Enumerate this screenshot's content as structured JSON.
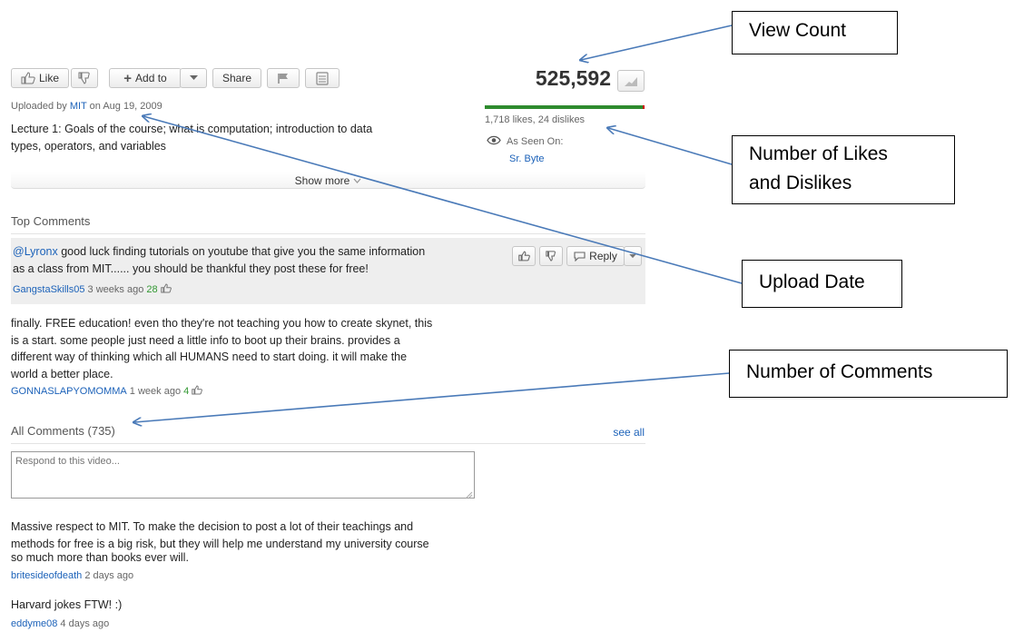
{
  "toolbar": {
    "like_label": "Like",
    "add_to_label": "Add to",
    "share_label": "Share"
  },
  "stats": {
    "view_count": "525,592",
    "likes_text": "1,718 likes, 24 dislikes",
    "like_ratio": 0.986,
    "seen_on_label": "As Seen On:",
    "seen_on_link": "Sr. Byte"
  },
  "upload": {
    "prefix": "Uploaded by ",
    "uploader": "MIT",
    "date_text": " on Aug 19, 2009"
  },
  "description": {
    "line1": "Lecture 1: Goals of the course; what is computation; introduction to data",
    "line2": "types, operators, and variables",
    "show_more": "Show more"
  },
  "top_comments": {
    "title": "Top Comments",
    "items": [
      {
        "mention": "@Lyronx",
        "line1": " good luck finding tutorials on youtube that give you the same information",
        "line2": "as a class from MIT...... you should be thankful they post these for free!",
        "author": "GangstaSkills05",
        "time": " 3 weeks ago ",
        "likes": "28",
        "reply_label": "Reply"
      },
      {
        "line1": "finally. FREE education! even tho they're not teaching you how to create skynet, this",
        "line2": "is a start. some people just need a little info to boot up their brains. provides a",
        "line3": "different way of thinking which all HUMANS need to start doing. it will make the",
        "line4": "world a better place.",
        "author": "GONNASLAPYOMOMMA",
        "time": " 1 week ago ",
        "likes": "4"
      }
    ]
  },
  "all_comments": {
    "title": "All Comments (735)",
    "see_all": "see all",
    "placeholder": "Respond to this video...",
    "items": [
      {
        "line1": "Massive respect to MIT. To make the decision to post a lot of their teachings and",
        "line2": "methods for free is a big risk, but they will help me understand my university course",
        "line3": "so much more than books ever will.",
        "author": "britesideofdeath",
        "time": " 2 days ago"
      },
      {
        "line1": "Harvard jokes FTW! :)",
        "author": "eddyme08",
        "time": " 4 days ago"
      }
    ]
  },
  "annotations": {
    "view_count": "View Count",
    "likes_line1": "Number of Likes",
    "likes_line2": "and Dislikes",
    "upload_date": "Upload Date",
    "comments": "Number of Comments"
  },
  "colors": {
    "link": "#1c62b9",
    "like_bar": "#2e8b2e",
    "arrow": "#4a7ab8",
    "likes_count": "#339933"
  }
}
